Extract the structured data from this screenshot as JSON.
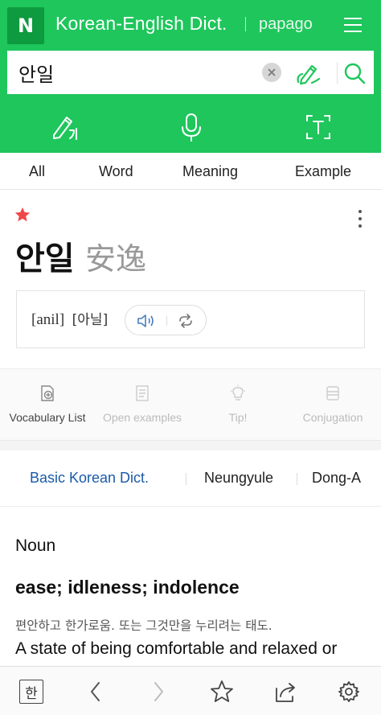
{
  "header": {
    "logo": "N",
    "title": "Korean-English Dict.",
    "papago": "papago"
  },
  "search": {
    "query": "안일"
  },
  "tabs": [
    "All",
    "Word",
    "Meaning",
    "Example"
  ],
  "entry": {
    "word": "안일",
    "hanja": "安逸",
    "romanization": "[anil]",
    "pronunciation": "[아닐]"
  },
  "actions": [
    "Vocabulary List",
    "Open examples",
    "Tip!",
    "Conjugation"
  ],
  "dicts": [
    "Basic Korean Dict.",
    "Neungyule",
    "Dong-A"
  ],
  "definition": {
    "pos": "Noun",
    "meaning": "ease; idleness; indolence",
    "ko": "편안하고 한가로움. 또는 그것만을 누리려는 태도.",
    "en": "A state of being comfortable and relaxed or"
  },
  "bottom": {
    "han": "한"
  },
  "colors": {
    "brand_green": "#1ec65c",
    "logo_green": "#0e9a3f",
    "active_dict_blue": "#1a5aa8",
    "star_red": "#f04848"
  }
}
